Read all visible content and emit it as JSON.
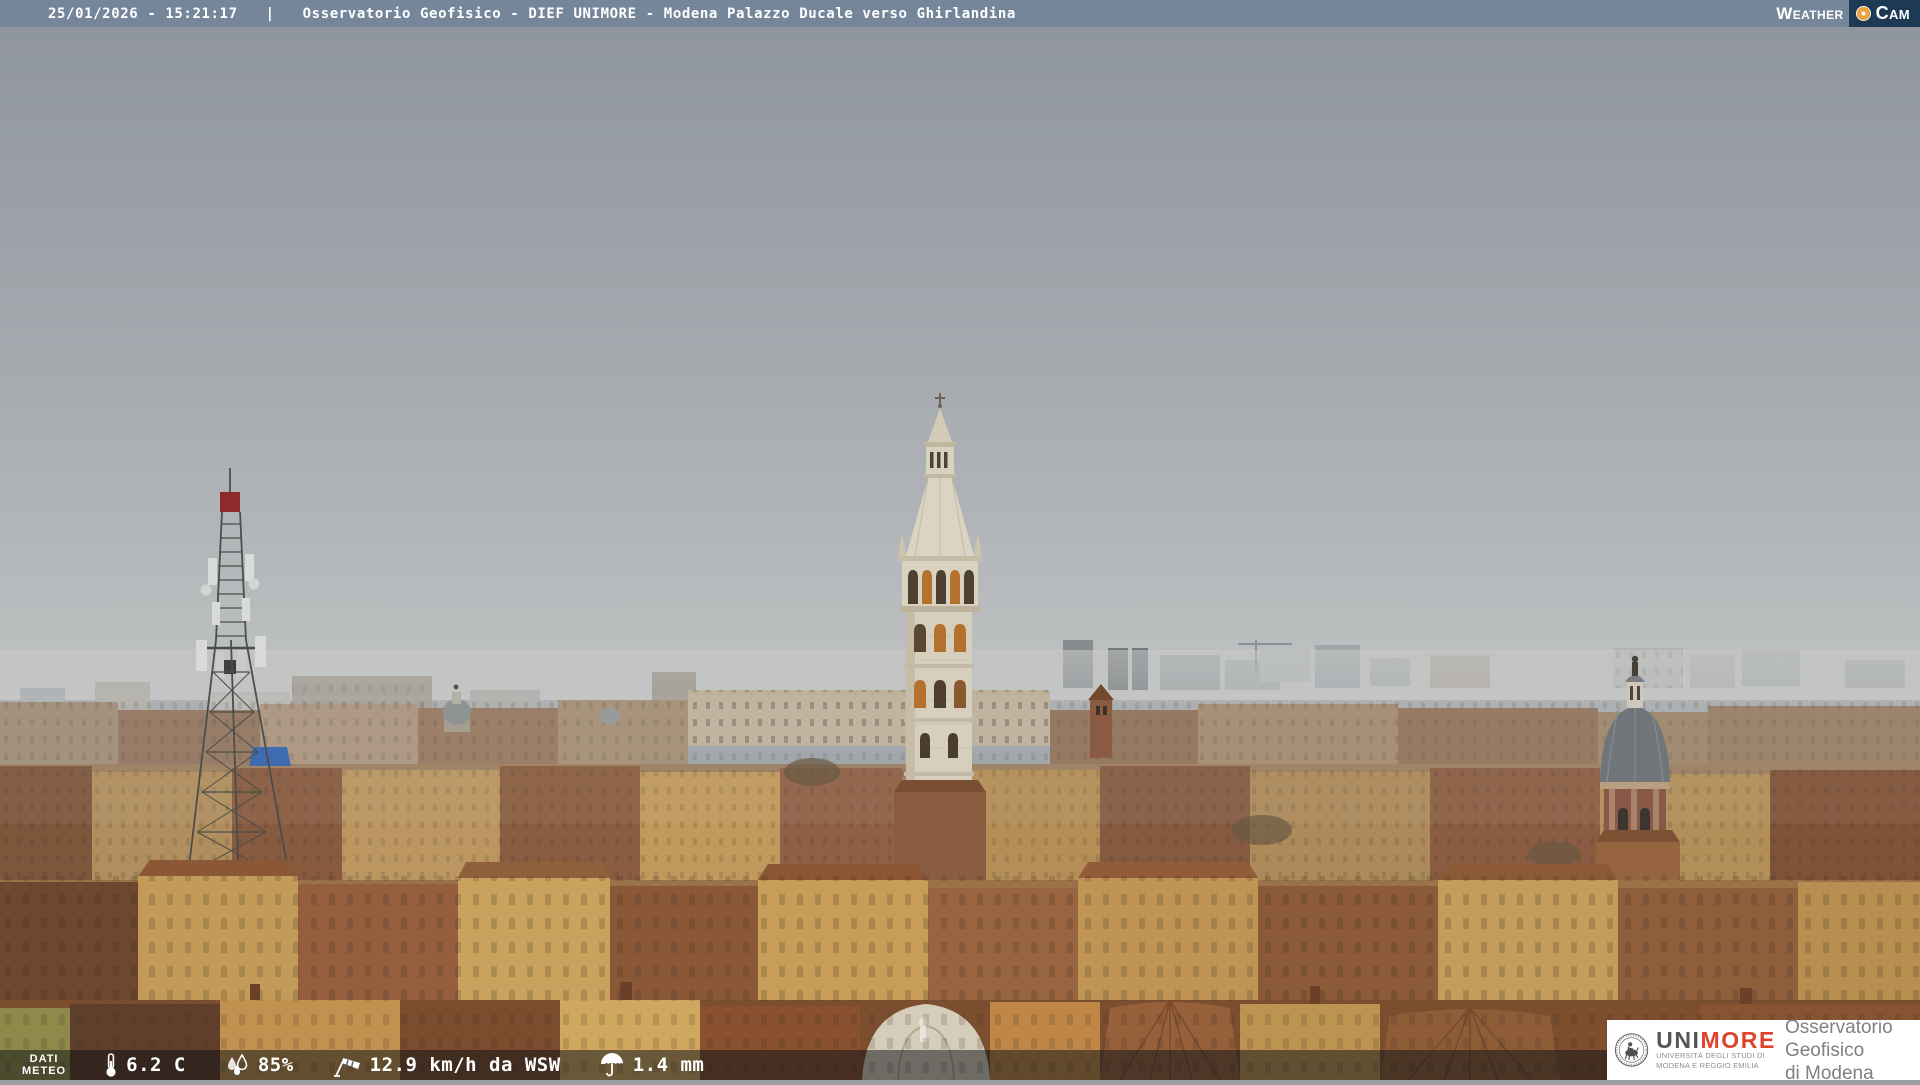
{
  "header": {
    "timestamp": "25/01/2026 - 15:21:17",
    "separator": "|",
    "title": "Osservatorio Geofisico - DIEF UNIMORE - Modena Palazzo Ducale verso Ghirlandina",
    "weathercam": {
      "weather": "Weather",
      "cam": "Cam"
    },
    "colors": {
      "bar_bg": "#75869b",
      "cam_box_bg": "#1d3a55",
      "lens_orange": "#e8a33d"
    }
  },
  "scene": {
    "description": "Overcast daytime webcam view over the rooftops of Modena: Ghirlandina tower in the centre, telecom lattice tower on the left, church dome on the right",
    "landmarks": [
      "telecom-lattice-tower",
      "ghirlandina-tower",
      "church-dome"
    ],
    "sky_colors": {
      "top": "#8e949c",
      "horizon": "#c0c2c2"
    }
  },
  "footer": {
    "dati_line1": "DATI",
    "dati_line2": "METEO",
    "items": [
      {
        "icon": "thermometer-icon",
        "value": "6.2 C"
      },
      {
        "icon": "humidity-icon",
        "value": "85%"
      },
      {
        "icon": "wind-icon",
        "value": "12.9 km/h da WSW"
      },
      {
        "icon": "umbrella-icon",
        "value": "1.4 mm"
      }
    ]
  },
  "logo_box": {
    "brand_uni": "UNI",
    "brand_more": "MORE",
    "university_line1": "UNIVERSITÀ DEGLI STUDI DI",
    "university_line2": "MODENA E REGGIO EMILIA",
    "org_line1": "Osservatorio Geofisico",
    "org_line2": "di Modena",
    "colors": {
      "uni": "#55565a",
      "more": "#e0432d",
      "org_text": "#7e8083"
    }
  }
}
